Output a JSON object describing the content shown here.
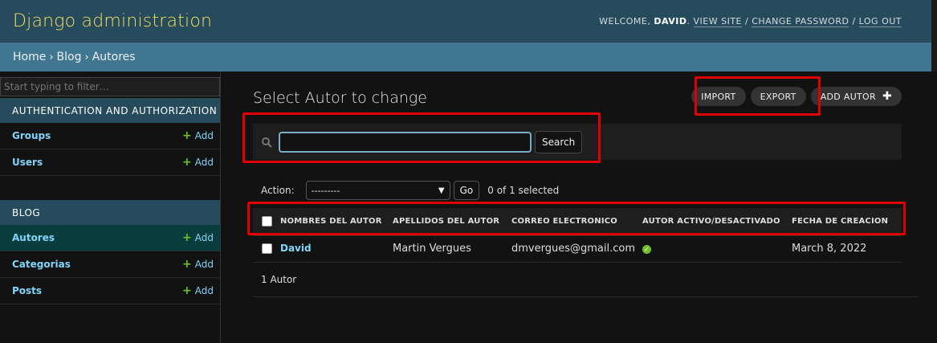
{
  "header": {
    "branding": "Django administration",
    "welcome": "Welcome,",
    "user": "David",
    "view_site": "View site",
    "change_password": "Change password",
    "log_out": "Log out"
  },
  "breadcrumbs": [
    "Home",
    "Blog",
    "Autores"
  ],
  "sidebar": {
    "filter_placeholder": "Start typing to filter…",
    "add_label": "Add",
    "apps": [
      {
        "caption": "Authentication and Authorization",
        "models": [
          "Groups",
          "Users"
        ]
      },
      {
        "caption": "Blog",
        "models": [
          "Autores",
          "Categorias",
          "Posts"
        ],
        "current": "Autores"
      }
    ]
  },
  "main": {
    "title": "Select Autor to change",
    "tools": {
      "import": "Import",
      "export": "Export",
      "add": "Add Autor"
    },
    "search": {
      "value": "",
      "button": "Search"
    },
    "actions": {
      "label": "Action:",
      "selected_option": "---------",
      "go": "Go",
      "selected_count": "0 of 1 selected"
    },
    "table": {
      "columns": [
        "Nombres del autor",
        "Apellidos del autor",
        "Correo electronico",
        "Autor activo/desactivado",
        "Fecha de creacion"
      ],
      "rows": [
        {
          "nombres": "David",
          "apellidos": "Martin Vergues",
          "correo": "dmvergues@gmail.com",
          "activo": true,
          "fecha": "March 8, 2022"
        }
      ]
    },
    "paginator": "1 Autor"
  },
  "colors": {
    "header_bg": "#264b5d",
    "breadcrumb_bg": "#417690",
    "branding": "#f5dd5d",
    "link": "#81d4fa",
    "highlight_box": "#e00000",
    "success": "#70bf2b"
  }
}
